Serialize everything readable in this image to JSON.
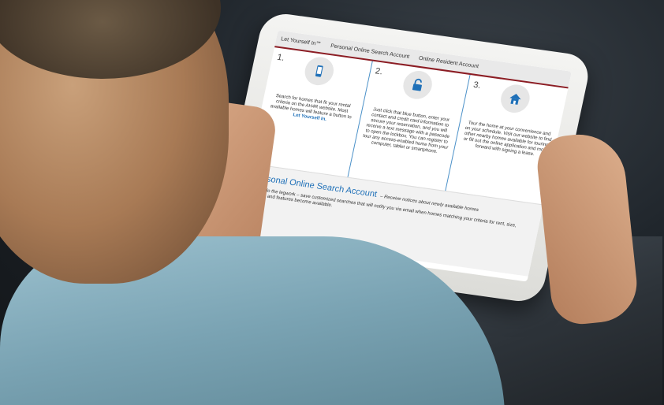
{
  "tabs": [
    "Let Yourself In℠",
    "Personal Online Search Account",
    "Online Resident Account"
  ],
  "steps": [
    {
      "num": "1.",
      "icon": "phone-icon",
      "text": "Search for homes that fit your rental criteria on the AH4R website. Most available homes will feature a button to ",
      "link": "Let Yourself In."
    },
    {
      "num": "2.",
      "icon": "lock-icon",
      "text": "Just click that blue button, enter your contact and credit card information to secure your reservation, and you will receive a text message with a passcode to open the lockbox. You can register to tour any access-enabled home from your computer, tablet or smartphone."
    },
    {
      "num": "3.",
      "icon": "home-icon",
      "text": "Tour the home at your convenience and on your schedule. Visit our website to find other nearby homes available for touring, or fill out the online application and move forward with signing a lease."
    }
  ],
  "account": {
    "title": "Personal Online Search Account",
    "subtitle": "– Receive notices about newly available homes",
    "body": "Let us do the legwork – save customized searches that will notify you via email when homes matching your criteria for rent, size, location and features become available."
  }
}
